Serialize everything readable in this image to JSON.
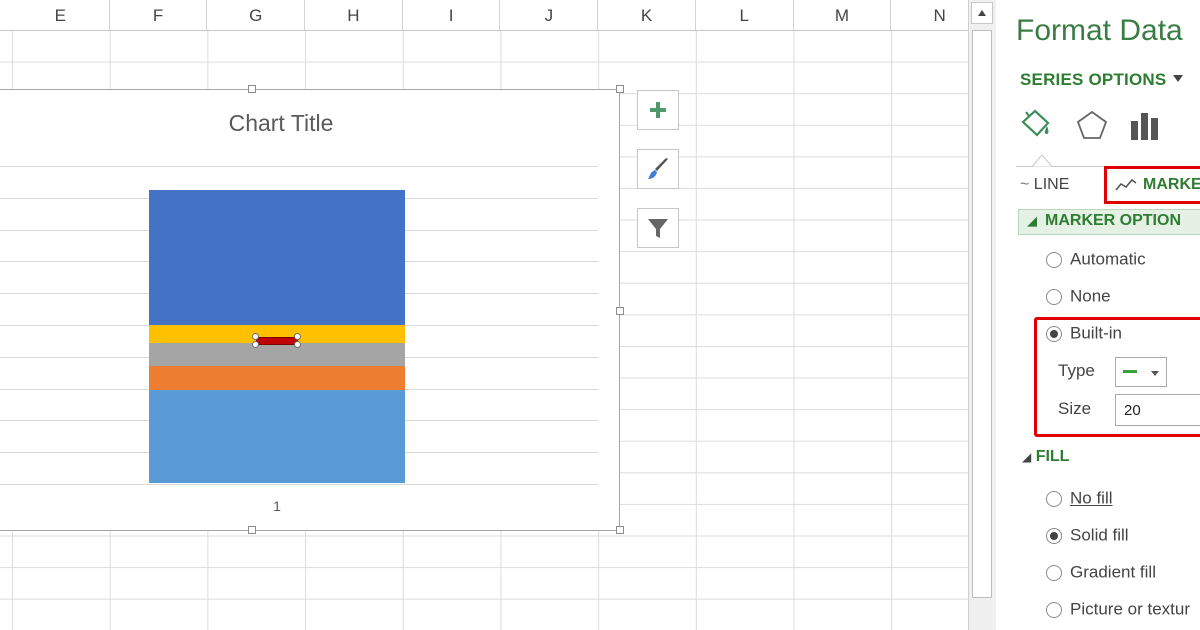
{
  "columns": [
    "E",
    "F",
    "G",
    "H",
    "I",
    "J",
    "K",
    "L",
    "M",
    "N"
  ],
  "chart": {
    "title": "Chart Title",
    "category_label": "1"
  },
  "chart_data": {
    "type": "bar",
    "title": "Chart Title",
    "categories": [
      "1"
    ],
    "stacked": true,
    "segments": [
      {
        "color": "#5b9bd5",
        "fraction": 0.32
      },
      {
        "color": "#ed7d31",
        "fraction": 0.08
      },
      {
        "color": "#a5a5a5",
        "fraction": 0.08
      },
      {
        "color": "#ffc000",
        "fraction": 0.06
      },
      {
        "color": "#4472c4",
        "fraction": 0.46
      }
    ],
    "selected_marker_color": "#c00000",
    "grid": true,
    "xlabel": "",
    "ylabel": ""
  },
  "chart_buttons": {
    "elements": "plus-icon",
    "styles": "paintbrush-icon",
    "filters": "filter-icon"
  },
  "pane": {
    "title": "Format Data",
    "series_options": "SERIES OPTIONS",
    "tabs": {
      "line": "LINE",
      "marker": "MARKE"
    },
    "marker_options": {
      "heading": "MARKER OPTION",
      "automatic": "Automatic",
      "none": "None",
      "builtin": "Built-in",
      "type_label": "Type",
      "size_label": "Size",
      "size_value": "20"
    },
    "fill": {
      "heading": "FILL",
      "no_fill": "No fill",
      "solid_fill": "Solid fill",
      "gradient_fill": "Gradient fill",
      "picture": "Picture or textur"
    }
  },
  "colors": {
    "accent": "#2e7d32",
    "highlight": "#e00000"
  }
}
